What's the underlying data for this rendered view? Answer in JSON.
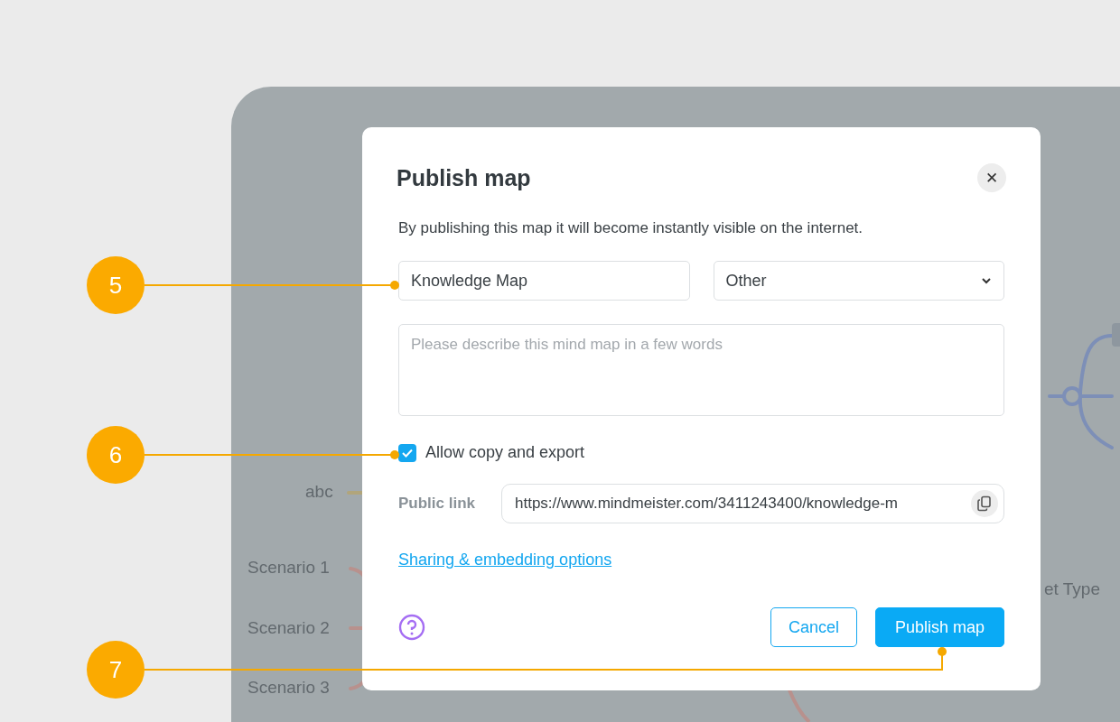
{
  "background_map": {
    "nodes": [
      {
        "label": "abc"
      },
      {
        "label": "Scenario 1"
      },
      {
        "label": "Scenario 2"
      },
      {
        "label": "Scenario 3"
      },
      {
        "label": "et Type"
      }
    ]
  },
  "dialog": {
    "title": "Publish map",
    "close_label": "✕",
    "description": "By publishing this map it will become instantly visible on the internet.",
    "name_field": {
      "value": "Knowledge Map"
    },
    "category_select": {
      "value": "Other"
    },
    "description_field": {
      "placeholder": "Please describe this mind map in a few words"
    },
    "allow_copy": {
      "label": "Allow copy and export",
      "checked": true
    },
    "public_link": {
      "label": "Public link",
      "value": "https://www.mindmeister.com/3411243400/knowledge-m"
    },
    "sharing_link": "Sharing & embedding options",
    "buttons": {
      "cancel": "Cancel",
      "publish": "Publish map"
    }
  },
  "callouts": [
    {
      "number": "5"
    },
    {
      "number": "6"
    },
    {
      "number": "7"
    }
  ]
}
